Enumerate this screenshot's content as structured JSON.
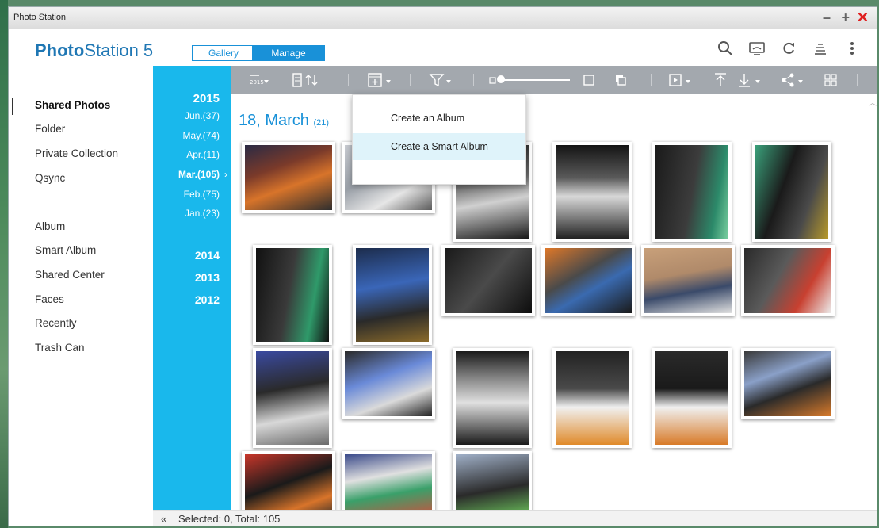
{
  "window": {
    "title": "Photo Station"
  },
  "app": {
    "logo_bold": "Photo",
    "logo_rest": "Station 5"
  },
  "mode": {
    "gallery": "Gallery",
    "manage": "Manage"
  },
  "header_icons": [
    "search-icon",
    "cast-icon",
    "refresh-icon",
    "stack-icon",
    "more-icon"
  ],
  "sidebar": {
    "items": [
      "Shared Photos",
      "Folder",
      "Private Collection",
      "Qsync",
      "Album",
      "Smart Album",
      "Shared Center",
      "Faces",
      "Recently",
      "Trash Can"
    ],
    "active": "Shared Photos"
  },
  "timeline": {
    "year_2015": "2015",
    "months": [
      "Jun.(37)",
      "May.(74)",
      "Apr.(11)",
      "Mar.(105)",
      "Feb.(75)",
      "Jan.(23)"
    ],
    "active_month": "Mar.(105)",
    "other_years": [
      "2014",
      "2013",
      "2012"
    ]
  },
  "toolbar": {
    "year_icon_text": "2015"
  },
  "dropdown": {
    "items": [
      "Create an Album",
      "Create a Smart Album"
    ]
  },
  "content": {
    "date_title": "18, March",
    "date_count": "(21)"
  },
  "status": {
    "collapse": "«",
    "text": "Selected: 0, Total: 105"
  },
  "colors": {
    "accent": "#1991d8",
    "timeline": "#19b8ec",
    "toolbar": "#a3a8ae",
    "close": "#e02020"
  }
}
